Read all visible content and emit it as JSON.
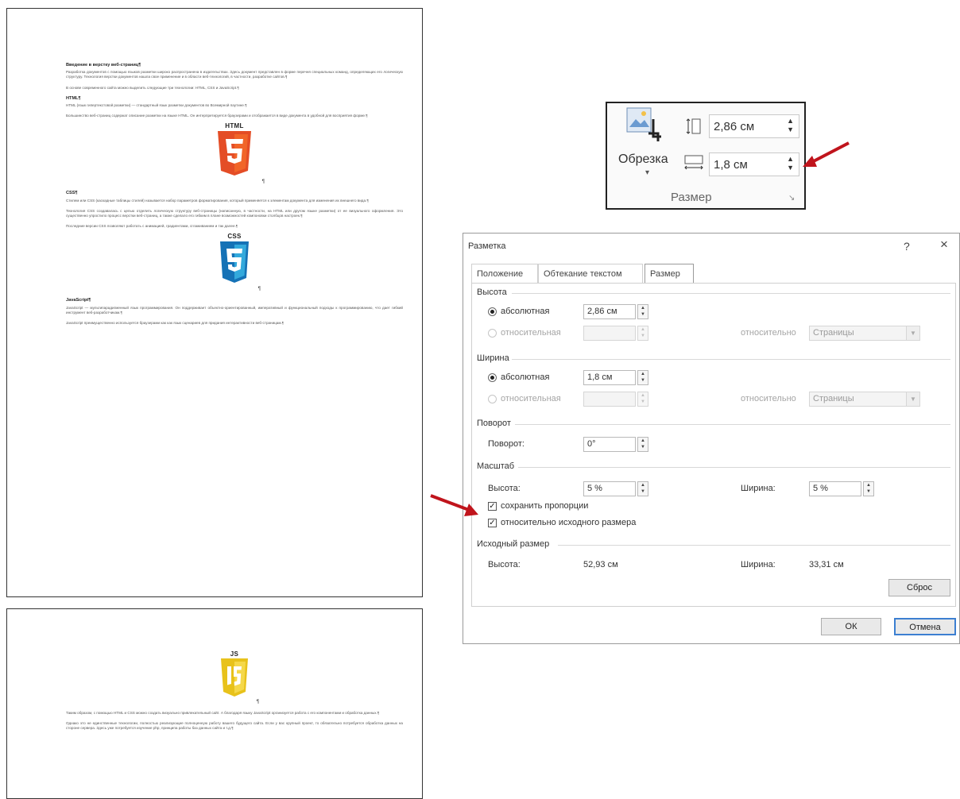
{
  "document": {
    "page1": {
      "heading_intro": "Введение в верстку веб-страниц¶",
      "para_intro1": "Разработка документов с помощью языков разметки широко распространена в издательствах. Здесь документ представлен в форме перечня специальных команд, определяющих его логическую структуру. Технология верстки документов нашла свое применение и в области веб-технологий, в частности, разработке сайтов.¶",
      "para_intro2": "В основе современного сайта можно выделить следующие три технологии: HTML, CSS и JavaScript.¶",
      "heading_html": "HTML¶",
      "para_html1": "HTML (язык гипертекстовой разметки) — стандартный язык разметки документов во Всемирной паутине.¶",
      "para_html2": "Большинство веб-страниц содержат описание разметки на языке HTML. Он интерпретируется браузерами и отображается в виде документа в удобной для восприятия форме.¶",
      "logo_html_caption": "HTML",
      "heading_css": "CSS¶",
      "para_css1": "Стилем или CSS (каскадные таблицы стилей) называется набор параметров форматирования, который применяется к элементам документа для изменения их внешнего вида.¶",
      "para_css2": "Технология CSS создавалась с целью отделить логическую структуру веб-страницы (написанную, в частности, на HTML или другом языке разметки) от ее визуального оформления. Это существенно упростило процесс верстки веб-страниц, а также сделало его гибким в плане возможностей компоновки столбцов настроек.¶",
      "para_css3": "Последние версии CSS позволяют работать с анимацией, градиентами, сглаживанием и так далее.¶",
      "logo_css_caption": "CSS",
      "heading_js": "JavaScript¶",
      "para_js1": "JavaScript — мультипарадигменный язык программирования. Он поддерживает объектно-ориентированный, императивный и функциональный подходы к программированию, что дает гибкий инструмент веб-разработчикам.¶",
      "para_js2": "JavaScript преимущественно используется браузерами как как язык сценариев для придания интерактивности веб-страницам.¶",
      "pilcrow": "¶"
    },
    "page2": {
      "logo_js_caption": "JS",
      "para_end1": "Таким образом, с помощью HTML и CSS можно создать визуально привлекательный сайт. А благодаря языку JavaScript организуется работа с его компонентами и обработка данных.¶",
      "para_end2": "Однако это не единственные технологии, полностью реализующие полноценную работу вашего будущего сайта. Если у вас крупный проект, то обязательно потребуется обработка данных на стороне сервера. Здесь уже потребуется изучение php, принципа работы баз данных сайта и т.д.¶",
      "pilcrow": "¶"
    }
  },
  "ribbon": {
    "crop_label": "Обрезка",
    "height_value": "2,86 см",
    "width_value": "1,8 см",
    "group_label": "Размер",
    "spin_up": "▲",
    "spin_down": "▼",
    "crop_dropdown": "▾",
    "launcher": "↘"
  },
  "dialog": {
    "title": "Разметка",
    "help": "?",
    "close": "×",
    "tabs": [
      "Положение",
      "Обтекание текстом",
      "Размер"
    ],
    "height_section": "Высота",
    "height_absolute_label": "абсолютная",
    "height_absolute_value": "2,86 см",
    "height_relative_label": "относительная",
    "height_relative_to": "относительно",
    "height_relative_select": "Страницы",
    "width_section": "Ширина",
    "width_absolute_label": "абсолютная",
    "width_absolute_value": "1,8 см",
    "width_relative_label": "относительная",
    "width_relative_to": "относительно",
    "width_relative_select": "Страницы",
    "rotate_section": "Поворот",
    "rotate_label": "Поворот:",
    "rotate_value": "0°",
    "scale_section": "Масштаб",
    "scale_height_label": "Высота:",
    "scale_height_value": "5 %",
    "scale_width_label": "Ширина:",
    "scale_width_value": "5 %",
    "lock_aspect_label": "сохранить пропорции",
    "relative_original_label": "относительно исходного размера",
    "original_section": "Исходный размер",
    "original_height_label": "Высота:",
    "original_height_value": "52,93 см",
    "original_width_label": "Ширина:",
    "original_width_value": "33,31 см",
    "reset_button": "Сброс",
    "ok_button": "ОК",
    "cancel_button": "Отмена",
    "spin_up": "▲",
    "spin_down": "▼",
    "check_mark": "✓",
    "select_arrow": "▼"
  },
  "colors": {
    "html5_orange": "#e44d26",
    "css3_blue": "#1572b6",
    "js_yellow": "#e8c21b",
    "arrow_red": "#c0141c"
  },
  "icons": [
    "picture-crop-icon",
    "height-icon",
    "width-icon",
    "arrow-pointer-icon"
  ]
}
